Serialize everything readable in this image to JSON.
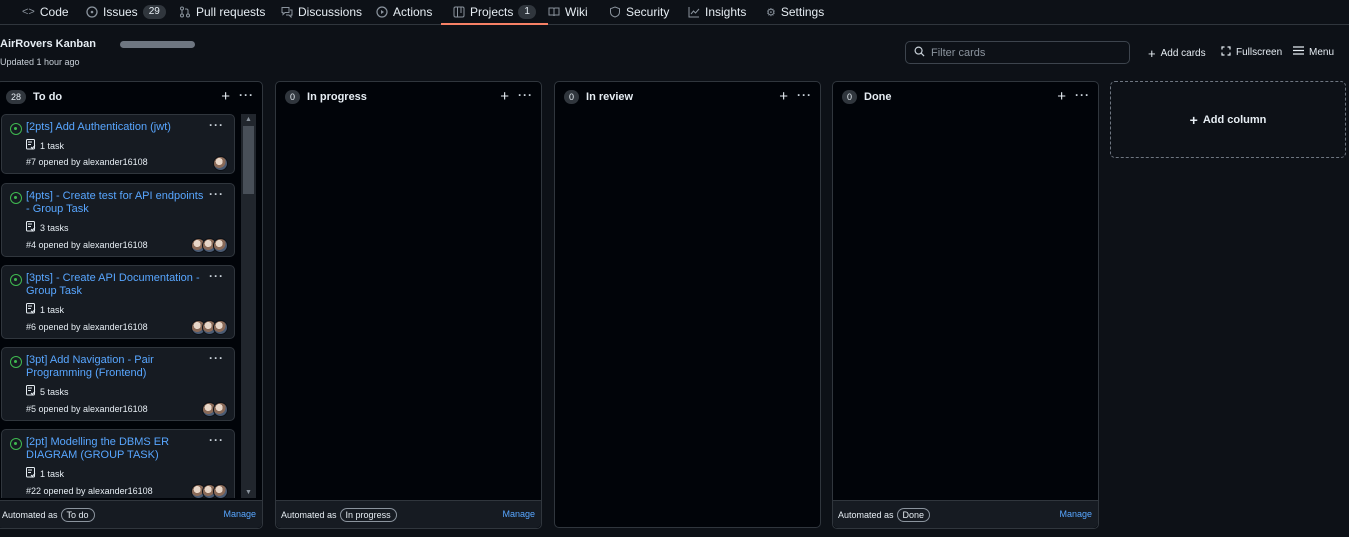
{
  "nav": {
    "items": [
      {
        "label": "Code",
        "icon": "code-icon"
      },
      {
        "label": "Issues",
        "count": "29",
        "icon": "issue-icon"
      },
      {
        "label": "Pull requests",
        "icon": "pull-request-icon"
      },
      {
        "label": "Discussions",
        "icon": "discussion-icon"
      },
      {
        "label": "Actions",
        "icon": "play-icon"
      },
      {
        "label": "Projects",
        "count": "1",
        "icon": "project-icon"
      },
      {
        "label": "Wiki",
        "icon": "book-icon"
      },
      {
        "label": "Security",
        "icon": "shield-icon"
      },
      {
        "label": "Insights",
        "icon": "graph-icon"
      },
      {
        "label": "Settings",
        "icon": "gear-icon"
      }
    ],
    "selected": "Projects"
  },
  "project": {
    "title": "AirRovers Kanban",
    "updated": "Updated 1 hour ago"
  },
  "header": {
    "filter_placeholder": "Filter cards",
    "add_cards": "Add cards",
    "fullscreen": "Fullscreen",
    "menu": "Menu"
  },
  "columns": [
    {
      "name": "To do",
      "count": "28",
      "automated_prefix": "Automated as",
      "automated_as": "To do",
      "manage": "Manage",
      "cards": [
        {
          "title": "[2pts] Add Authentication (jwt)",
          "tasks": "1 task",
          "meta": "#7 opened by alexander16108",
          "avatars": 1
        },
        {
          "title": "[4pts] - Create test for API endpoints - Group Task",
          "tasks": "3 tasks",
          "meta": "#4 opened by alexander16108",
          "avatars": 3
        },
        {
          "title": "[3pts] - Create API Documentation - Group Task",
          "tasks": "1 task",
          "meta": "#6 opened by alexander16108",
          "avatars": 3
        },
        {
          "title": "[3pt] Add Navigation - Pair Programming (Frontend)",
          "tasks": "5 tasks",
          "meta": "#5 opened by alexander16108",
          "avatars": 2
        },
        {
          "title": "[2pt] Modelling the DBMS ER DIAGRAM (GROUP TASK)",
          "tasks": "1 task",
          "meta": "#22 opened by alexander16108",
          "avatars": 3
        }
      ]
    },
    {
      "name": "In progress",
      "count": "0",
      "automated_prefix": "Automated as",
      "automated_as": "In progress",
      "manage": "Manage",
      "cards": []
    },
    {
      "name": "In review",
      "count": "0",
      "cards": []
    },
    {
      "name": "Done",
      "count": "0",
      "automated_prefix": "Automated as",
      "automated_as": "Done",
      "manage": "Manage",
      "cards": []
    }
  ],
  "add_column": "Add column",
  "colors": {
    "background": "#0d1117",
    "link": "#58a6ff",
    "open_issue": "#3fb950",
    "selected_tab": "#f78166",
    "border": "#30363d"
  }
}
